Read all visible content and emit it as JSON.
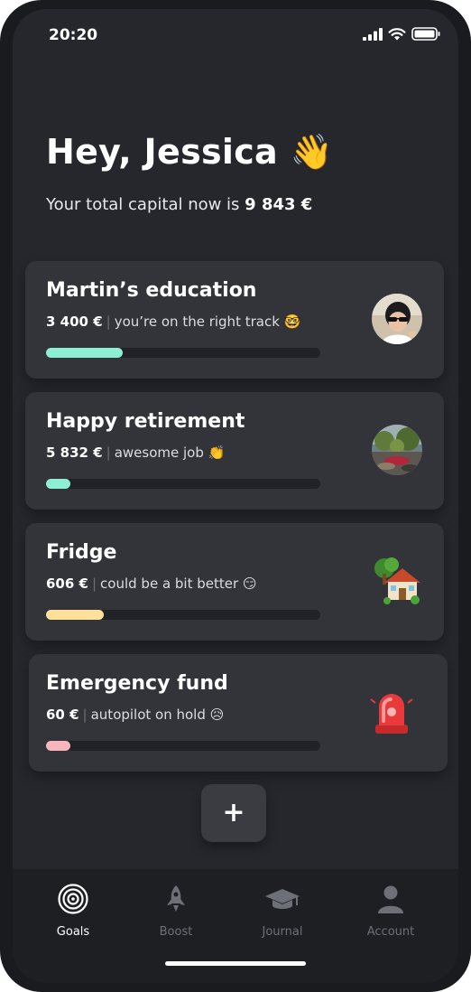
{
  "status_bar": {
    "time": "20:20"
  },
  "header": {
    "greeting": "Hey, Jessica 👋",
    "capital_prefix": "Your total capital now is",
    "capital_value": "9 843 €"
  },
  "goals": [
    {
      "title": "Martin’s education",
      "amount": "3 400 €",
      "message": "you’re on the right track 🤓",
      "progress": 0.28,
      "color": "#8ef0d2",
      "icon": "child-photo-icon"
    },
    {
      "title": "Happy retirement",
      "amount": "5 832 €",
      "message": "awesome job 👏",
      "progress": 0.09,
      "color": "#8ef0d2",
      "icon": "garden-photo-icon"
    },
    {
      "title": "Fridge",
      "amount": "606 €",
      "message": "could be a bit better 😏",
      "progress": 0.21,
      "color": "#fde09a",
      "icon": "house-with-garden-icon"
    },
    {
      "title": "Emergency fund",
      "amount": "60 €",
      "message": "autopilot on hold 😥",
      "progress": 0.09,
      "color": "#f9b6bd",
      "icon": "siren-light-icon"
    }
  ],
  "add_button": {
    "label": "+"
  },
  "tabs": [
    {
      "label": "Goals",
      "icon": "target-icon",
      "active": true
    },
    {
      "label": "Boost",
      "icon": "rocket-icon",
      "active": false
    },
    {
      "label": "Journal",
      "icon": "graduation-cap-icon",
      "active": false
    },
    {
      "label": "Account",
      "icon": "person-icon",
      "active": false
    }
  ]
}
